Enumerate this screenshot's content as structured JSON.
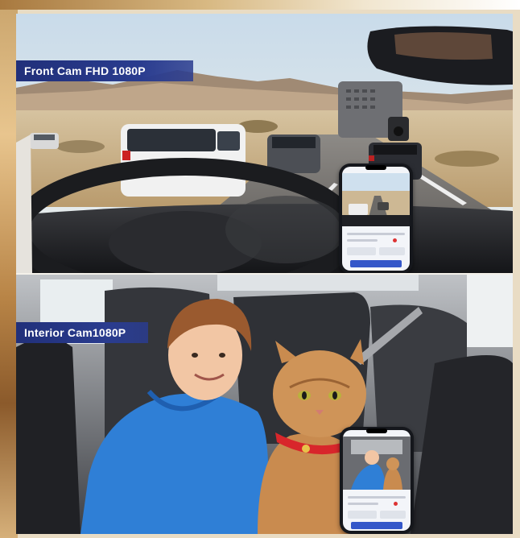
{
  "labels": {
    "front_cam": "Front Cam FHD 1080P",
    "interior_cam": "Interior Cam1080P"
  },
  "colors": {
    "banner": "#2a3c8f",
    "sky": "#dfe9f2",
    "desert": "#d9c49c",
    "hoodie": "#2f7fd6",
    "cat": "#c98b4f",
    "collar": "#d8262b"
  },
  "icons": [
    "dash-camera-icon",
    "smartphone-icon"
  ]
}
